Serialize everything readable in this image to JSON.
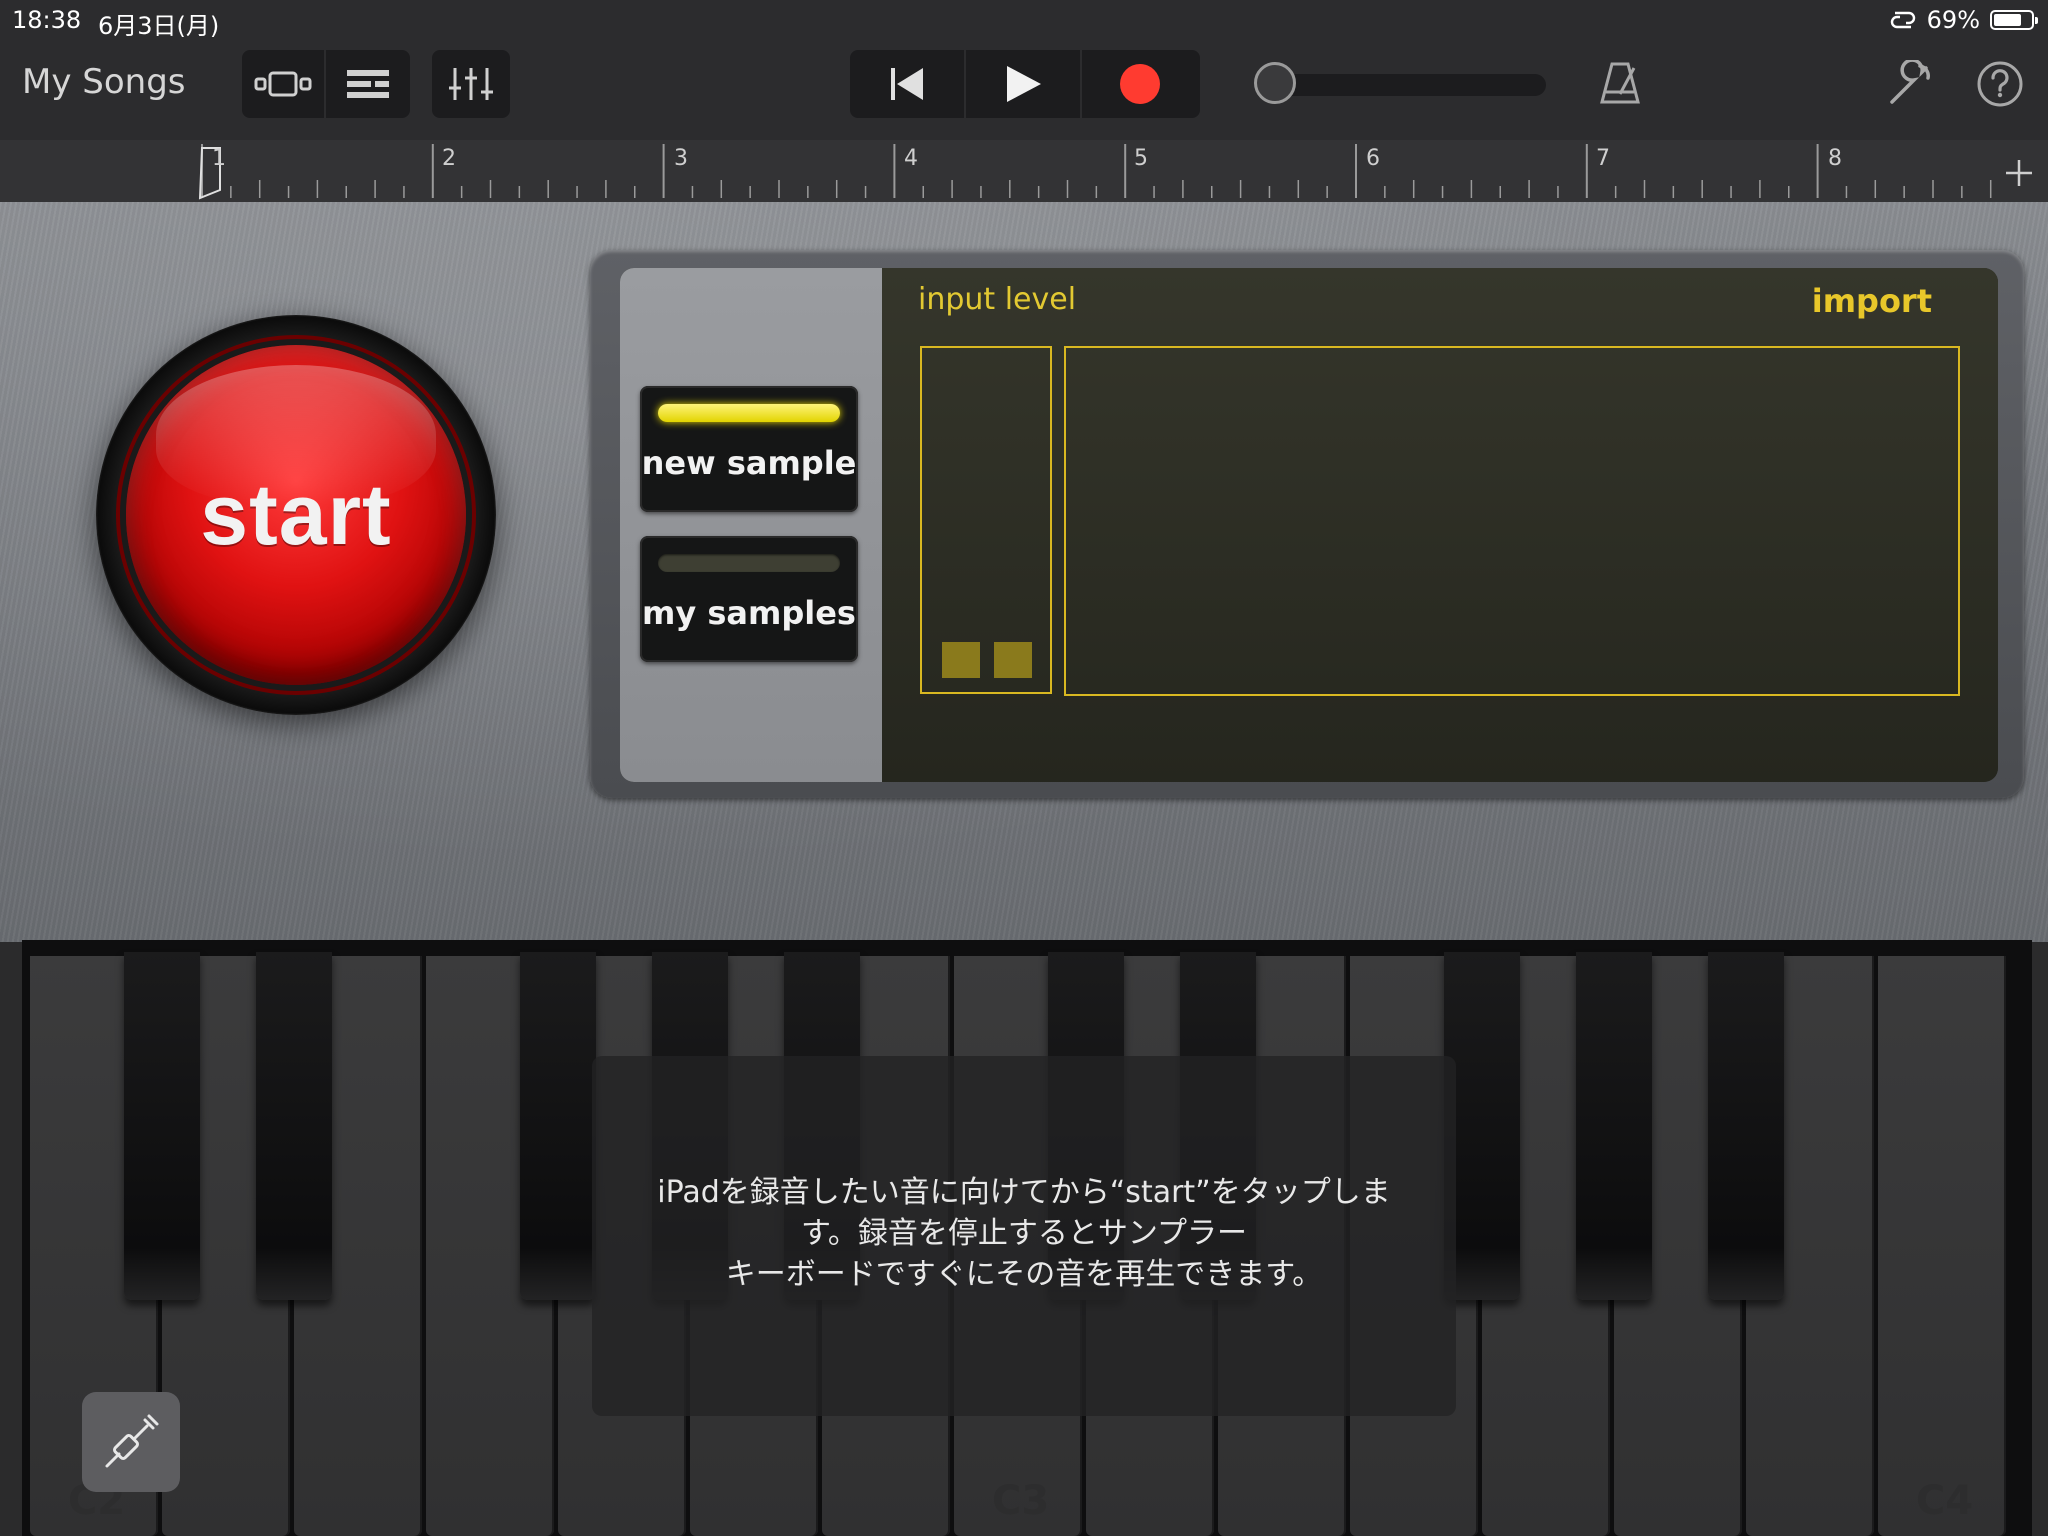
{
  "status": {
    "time": "18:38",
    "date": "6月3日(月)",
    "battery": "69%"
  },
  "toolbar": {
    "my_songs": "My Songs"
  },
  "ruler": {
    "marks": [
      "1",
      "2",
      "3",
      "4",
      "5",
      "6",
      "7",
      "8"
    ]
  },
  "sampler": {
    "start_label": "start",
    "new_sample": "new sample",
    "my_samples": "my samples",
    "input_level": "input level",
    "import": "import"
  },
  "keyboard": {
    "labels": [
      "C2",
      "C3",
      "C4"
    ]
  },
  "hint": {
    "text": "iPadを録音したい音に向けてから“start”をタップしま\nす。録音を停止するとサンプラー\nキーボードですぐにその音を再生できます。"
  },
  "colors": {
    "accent_yellow": "#e2c932",
    "record_red": "#ff3b30",
    "start_red": "#e01212"
  }
}
